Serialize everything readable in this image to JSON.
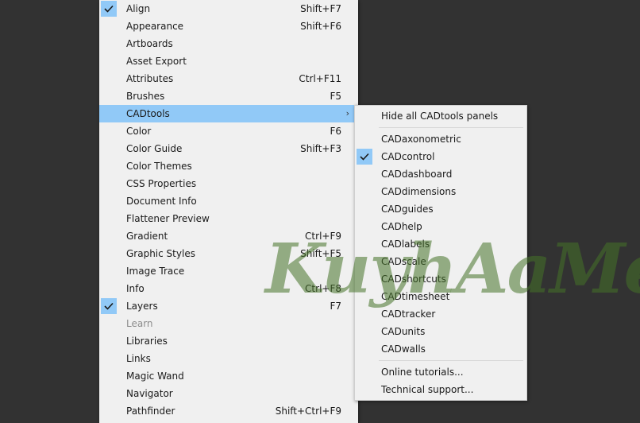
{
  "main_menu": {
    "items": [
      {
        "label": "Align",
        "shortcut": "Shift+F7",
        "checked": true
      },
      {
        "label": "Appearance",
        "shortcut": "Shift+F6"
      },
      {
        "label": "Artboards",
        "shortcut": ""
      },
      {
        "label": "Asset Export",
        "shortcut": ""
      },
      {
        "label": "Attributes",
        "shortcut": "Ctrl+F11"
      },
      {
        "label": "Brushes",
        "shortcut": "F5"
      },
      {
        "label": "CADtools",
        "shortcut": "",
        "submenu": true,
        "selected": true
      },
      {
        "label": "Color",
        "shortcut": "F6"
      },
      {
        "label": "Color Guide",
        "shortcut": "Shift+F3"
      },
      {
        "label": "Color Themes",
        "shortcut": ""
      },
      {
        "label": "CSS Properties",
        "shortcut": ""
      },
      {
        "label": "Document Info",
        "shortcut": ""
      },
      {
        "label": "Flattener Preview",
        "shortcut": ""
      },
      {
        "label": "Gradient",
        "shortcut": "Ctrl+F9"
      },
      {
        "label": "Graphic Styles",
        "shortcut": "Shift+F5"
      },
      {
        "label": "Image Trace",
        "shortcut": ""
      },
      {
        "label": "Info",
        "shortcut": "Ctrl+F8"
      },
      {
        "label": "Layers",
        "shortcut": "F7",
        "checked": true
      },
      {
        "label": "Learn",
        "shortcut": "",
        "disabled": true
      },
      {
        "label": "Libraries",
        "shortcut": ""
      },
      {
        "label": "Links",
        "shortcut": ""
      },
      {
        "label": "Magic Wand",
        "shortcut": ""
      },
      {
        "label": "Navigator",
        "shortcut": ""
      },
      {
        "label": "Pathfinder",
        "shortcut": "Shift+Ctrl+F9"
      }
    ]
  },
  "submenu": {
    "top": [
      {
        "label": "Hide all CADtools panels"
      }
    ],
    "panels": [
      {
        "label": "CADaxonometric"
      },
      {
        "label": "CADcontrol",
        "checked": true
      },
      {
        "label": "CADdashboard"
      },
      {
        "label": "CADdimensions"
      },
      {
        "label": "CADguides"
      },
      {
        "label": "CADhelp"
      },
      {
        "label": "CADlabels"
      },
      {
        "label": "CADscale"
      },
      {
        "label": "CADshortcuts"
      },
      {
        "label": "CADtimesheet"
      },
      {
        "label": "CADtracker"
      },
      {
        "label": "CADunits"
      },
      {
        "label": "CADwalls"
      }
    ],
    "bottom": [
      {
        "label": "Online tutorials..."
      },
      {
        "label": "Technical support..."
      }
    ]
  },
  "watermark": {
    "text": "KuyhAaMe"
  },
  "colors": {
    "highlight": "#91c9f7",
    "menu_bg": "#f0f0f0",
    "desktop_bg": "#323232"
  }
}
